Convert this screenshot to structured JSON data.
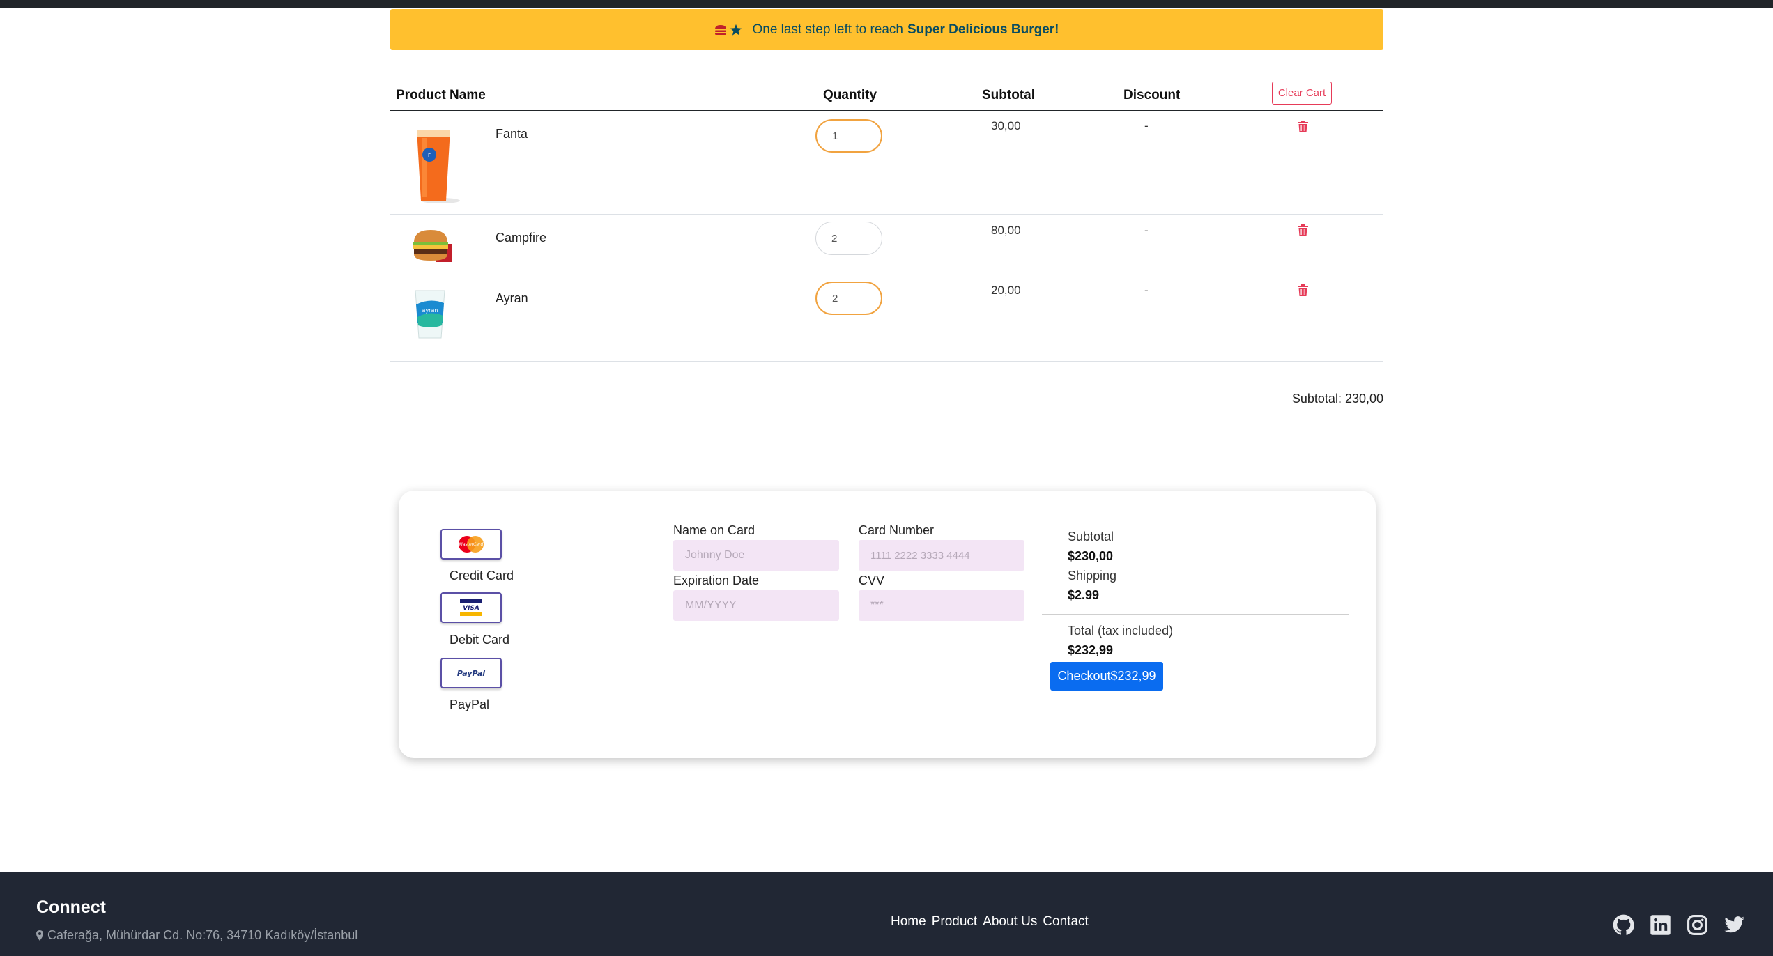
{
  "promo": {
    "text": "One last step left to reach",
    "bold": "Super Delicious Burger!"
  },
  "table": {
    "headers": {
      "product": "Product Name",
      "quantity": "Quantity",
      "subtotal": "Subtotal",
      "discount": "Discount"
    },
    "clear_cart": "Clear Cart",
    "rows": [
      {
        "name": "Fanta",
        "quantity": "1",
        "subtotal": "30,00",
        "discount": "-"
      },
      {
        "name": "Campfire",
        "quantity": "2",
        "subtotal": "80,00",
        "discount": "-"
      },
      {
        "name": "Ayran",
        "quantity": "2",
        "subtotal": "20,00",
        "discount": "-"
      }
    ],
    "subtotal_line": "Subtotal: 230,00"
  },
  "payment": {
    "methods": [
      {
        "label": "Credit Card",
        "logo": "MasterCard"
      },
      {
        "label": "Debit Card",
        "logo": "VISA"
      },
      {
        "label": "PayPal",
        "logo": "PayPal"
      }
    ],
    "fields": {
      "name_label": "Name on Card",
      "name_placeholder": "Johnny Doe",
      "card_label": "Card Number",
      "card_placeholder": "1111 2222 3333 4444",
      "exp_label": "Expiration Date",
      "exp_placeholder": "MM/YYYY",
      "cvv_label": "CVV",
      "cvv_placeholder": "***"
    },
    "summary": {
      "subtotal_label": "Subtotal",
      "subtotal_value": "$230,00",
      "shipping_label": "Shipping",
      "shipping_value": "$2.99",
      "total_label": "Total (tax included)",
      "total_value": "$232,99",
      "checkout": "Checkout$232,99"
    }
  },
  "footer": {
    "title": "Connect",
    "address": "Caferağa, Mühürdar Cd. No:76, 34710 Kadıköy/İstanbul",
    "nav": [
      "Home",
      "Product",
      "About Us",
      "Contact"
    ],
    "social_icons": [
      "github-icon",
      "linkedin-icon",
      "instagram-icon",
      "twitter-icon"
    ]
  },
  "colors": {
    "promo_bg": "#ffc02e",
    "accent_red": "#e63b58",
    "checkout_blue": "#0a6cf0",
    "footer_bg": "#212734",
    "input_bg": "#f3e5f5"
  }
}
